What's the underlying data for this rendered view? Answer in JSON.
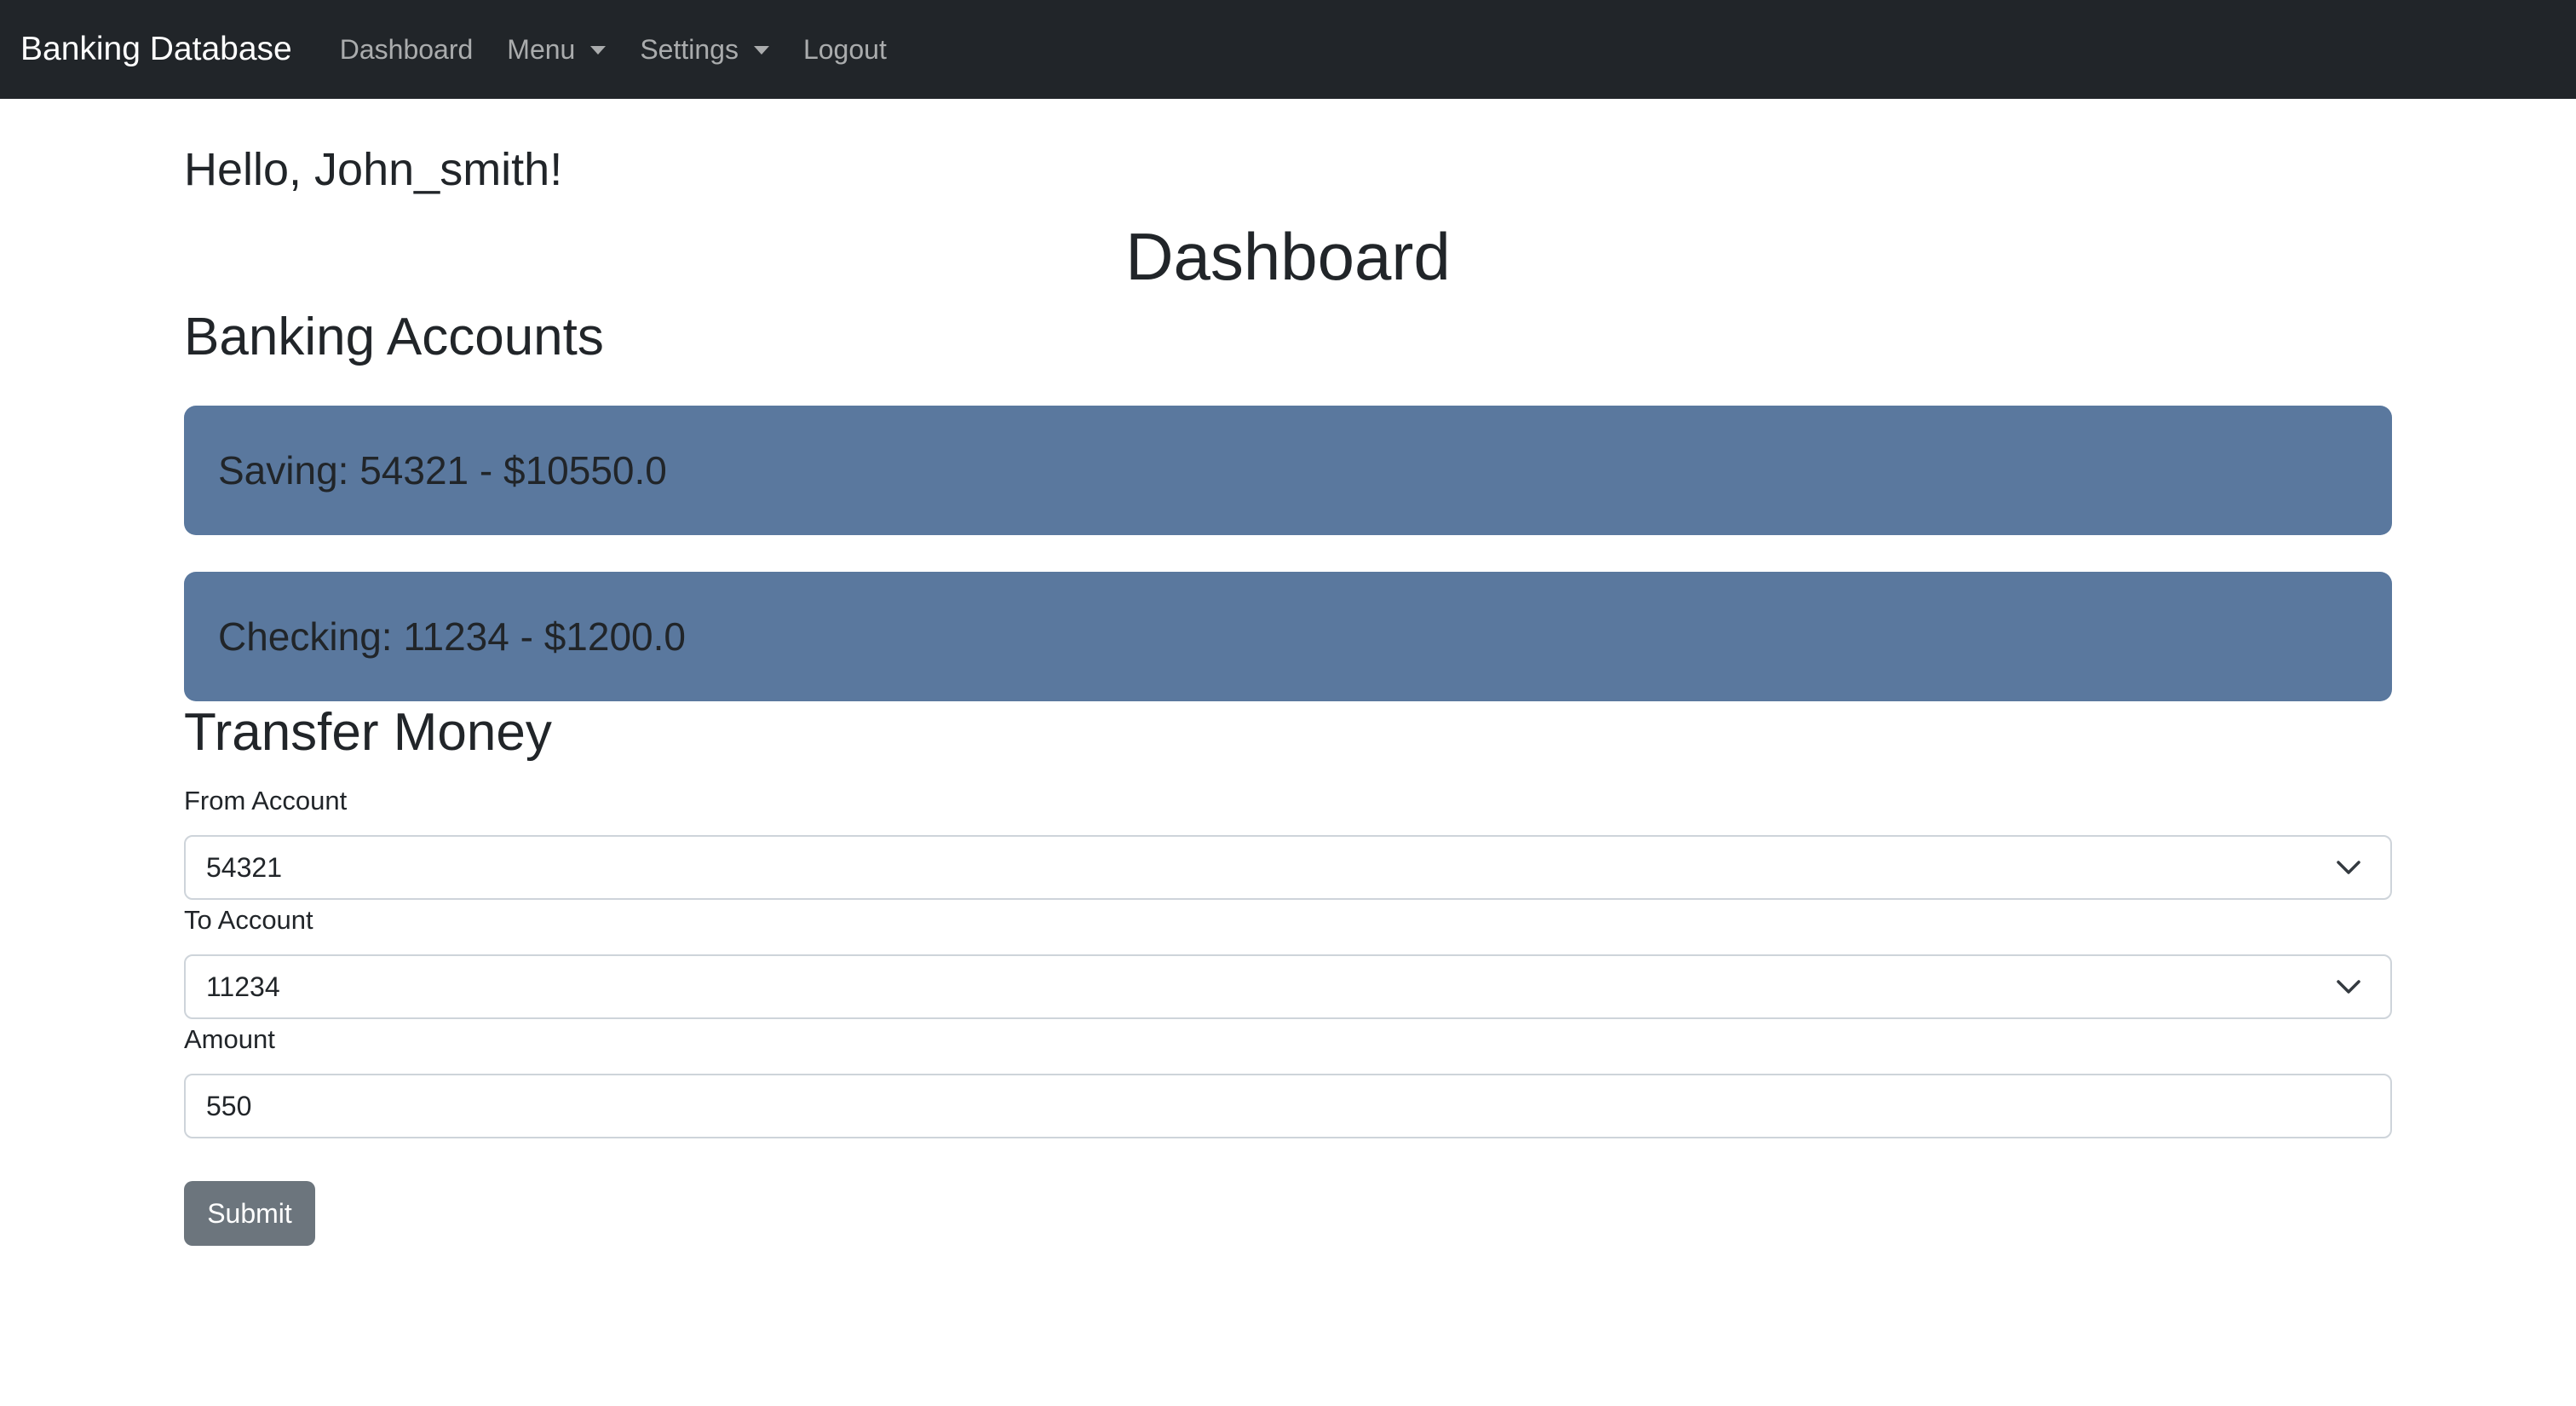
{
  "navbar": {
    "brand": "Banking Database",
    "items": [
      {
        "label": "Dashboard"
      },
      {
        "label": "Menu"
      },
      {
        "label": "Settings"
      },
      {
        "label": "Logout"
      }
    ]
  },
  "greeting": "Hello, John_smith!",
  "page_title": "Dashboard",
  "accounts_section": {
    "title": "Banking Accounts",
    "accounts": [
      {
        "text": "Saving: 54321 - $10550.0"
      },
      {
        "text": "Checking: 11234 - $1200.0"
      }
    ]
  },
  "transfer": {
    "title": "Transfer Money",
    "from_label": "From Account",
    "from_value": "54321",
    "to_label": "To Account",
    "to_value": "11234",
    "amount_label": "Amount",
    "amount_value": "550",
    "submit_label": "Submit"
  },
  "colors": {
    "navbar_bg": "#212529",
    "account_card_bg": "#5a789e",
    "submit_bg": "#6c757d"
  },
  "icons": {
    "dropdown_caret": "caret-down-icon",
    "select_chevron": "chevron-down-icon"
  }
}
